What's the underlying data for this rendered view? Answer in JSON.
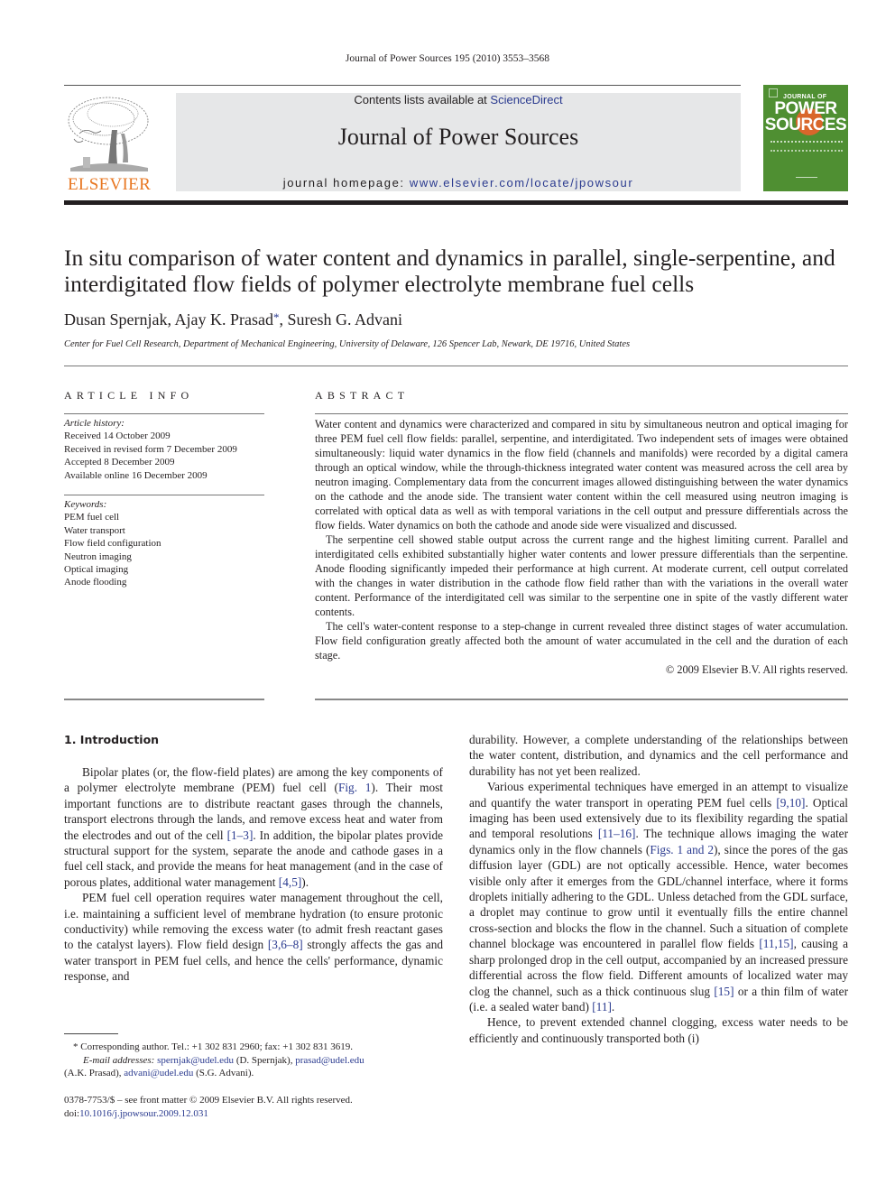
{
  "running_head": "Journal of Power Sources 195 (2010) 3553–3568",
  "publisher": {
    "name": "ELSEVIER",
    "logo_icon": "elsevier-tree-logo",
    "brand_color": "#e87722"
  },
  "masthead": {
    "contents_prefix": "Contents lists available at ",
    "contents_link": "ScienceDirect",
    "journal_name": "Journal of Power Sources",
    "homepage_prefix": "journal homepage: ",
    "homepage_url": "www.elsevier.com/locate/jpowsour",
    "background_color": "#e6e7e8",
    "link_color": "#2a3a8f"
  },
  "cover": {
    "top_text": "JOURNAL OF",
    "title_line1": "POWER",
    "title_line2": "SOURCES",
    "background_color": "#4f8f32",
    "accent_color": "#d9662b"
  },
  "article": {
    "title": "In situ comparison of water content and dynamics in parallel, single-serpentine, and interdigitated flow fields of polymer electrolyte membrane fuel cells",
    "authors": [
      {
        "name": "Dusan Spernjak",
        "sep": ", "
      },
      {
        "name": "Ajay K. Prasad",
        "marker": "*",
        "sep": ", "
      },
      {
        "name": "Suresh G. Advani",
        "sep": ""
      }
    ],
    "affiliation": "Center for Fuel Cell Research, Department of Mechanical Engineering, University of Delaware, 126 Spencer Lab, Newark, DE 19716, United States"
  },
  "article_info": {
    "heading": "ARTICLE INFO",
    "history_label": "Article history:",
    "history": [
      "Received 14 October 2009",
      "Received in revised form 7 December 2009",
      "Accepted 8 December 2009",
      "Available online 16 December 2009"
    ],
    "keywords_label": "Keywords:",
    "keywords": [
      "PEM fuel cell",
      "Water transport",
      "Flow field configuration",
      "Neutron imaging",
      "Optical imaging",
      "Anode flooding"
    ]
  },
  "abstract": {
    "heading": "ABSTRACT",
    "paragraphs": [
      "Water content and dynamics were characterized and compared in situ by simultaneous neutron and optical imaging for three PEM fuel cell flow fields: parallel, serpentine, and interdigitated. Two independent sets of images were obtained simultaneously: liquid water dynamics in the flow field (channels and manifolds) were recorded by a digital camera through an optical window, while the through-thickness integrated water content was measured across the cell area by neutron imaging. Complementary data from the concurrent images allowed distinguishing between the water dynamics on the cathode and the anode side. The transient water content within the cell measured using neutron imaging is correlated with optical data as well as with temporal variations in the cell output and pressure differentials across the flow fields. Water dynamics on both the cathode and anode side were visualized and discussed.",
      "The serpentine cell showed stable output across the current range and the highest limiting current. Parallel and interdigitated cells exhibited substantially higher water contents and lower pressure differentials than the serpentine. Anode flooding significantly impeded their performance at high current. At moderate current, cell output correlated with the changes in water distribution in the cathode flow field rather than with the variations in the overall water content. Performance of the interdigitated cell was similar to the serpentine one in spite of the vastly different water contents.",
      "The cell's water-content response to a step-change in current revealed three distinct stages of water accumulation. Flow field configuration greatly affected both the amount of water accumulated in the cell and the duration of each stage."
    ],
    "copyright": "© 2009 Elsevier B.V. All rights reserved."
  },
  "introduction": {
    "heading": "1.  Introduction",
    "left_column": [
      [
        {
          "t": "Bipolar plates (or, the flow-field plates) are among the key components of a polymer electrolyte membrane (PEM) fuel cell ("
        },
        {
          "t": "Fig. 1",
          "link": true
        },
        {
          "t": "). Their most important functions are to distribute reactant gases through the channels, transport electrons through the lands, and remove excess heat and water from the electrodes and out of the cell "
        },
        {
          "t": "[1–3]",
          "link": true
        },
        {
          "t": ". In addition, the bipolar plates provide structural support for the system, separate the anode and cathode gases in a fuel cell stack, and provide the means for heat management (and in the case of porous plates, additional water management "
        },
        {
          "t": "[4,5]",
          "link": true
        },
        {
          "t": ")."
        }
      ],
      [
        {
          "t": "PEM fuel cell operation requires water management throughout the cell, i.e. maintaining a sufficient level of membrane hydration (to ensure protonic conductivity) while removing the excess water (to admit fresh reactant gases to the catalyst layers). Flow field design "
        },
        {
          "t": "[3,6–8]",
          "link": true
        },
        {
          "t": " strongly affects the gas and water transport in PEM fuel cells, and hence the cells' performance, dynamic response, and"
        }
      ]
    ],
    "right_column": [
      [
        {
          "t": "durability. However, a complete understanding of the relationships between the water content, distribution, and dynamics and the cell performance and durability has not yet been realized."
        }
      ],
      [
        {
          "t": "Various experimental techniques have emerged in an attempt to visualize and quantify the water transport in operating PEM fuel cells "
        },
        {
          "t": "[9,10]",
          "link": true
        },
        {
          "t": ". Optical imaging has been used extensively due to its flexibility regarding the spatial and temporal resolutions "
        },
        {
          "t": "[11–16]",
          "link": true
        },
        {
          "t": ". The technique allows imaging the water dynamics only in the flow channels ("
        },
        {
          "t": "Figs. 1 and 2",
          "link": true
        },
        {
          "t": "), since the pores of the gas diffusion layer (GDL) are not optically accessible. Hence, water becomes visible only after it emerges from the GDL/channel interface, where it forms droplets initially adhering to the GDL. Unless detached from the GDL surface, a droplet may continue to grow until it eventually fills the entire channel cross-section and blocks the flow in the channel. Such a situation of complete channel blockage was encountered in parallel flow fields "
        },
        {
          "t": "[11,15]",
          "link": true
        },
        {
          "t": ", causing a sharp prolonged drop in the cell output, accompanied by an increased pressure differential across the flow field. Different amounts of localized water may clog the channel, such as a thick continuous slug "
        },
        {
          "t": "[15]",
          "link": true
        },
        {
          "t": " or a thin film of water (i.e. a sealed water band) "
        },
        {
          "t": "[11]",
          "link": true
        },
        {
          "t": "."
        }
      ],
      [
        {
          "t": "Hence, to prevent extended channel clogging, excess water needs to be efficiently and continuously transported both (i)"
        }
      ]
    ]
  },
  "footnotes": {
    "corresponding_marker": "*",
    "corresponding_text": "Corresponding author. Tel.: +1 302 831 2960; fax: +1 302 831 3619.",
    "email_label": "E-mail addresses:",
    "emails": [
      {
        "address": "spernjak@udel.edu",
        "owner": "(D. Spernjak)"
      },
      {
        "address": "prasad@udel.edu",
        "owner": "(A.K. Prasad)"
      },
      {
        "address": "advani@udel.edu",
        "owner": "(S.G. Advani)."
      }
    ]
  },
  "front_matter": {
    "issn_line": "0378-7753/$ – see front matter © 2009 Elsevier B.V. All rights reserved.",
    "doi_prefix": "doi:",
    "doi": "10.1016/j.jpowsour.2009.12.031"
  }
}
